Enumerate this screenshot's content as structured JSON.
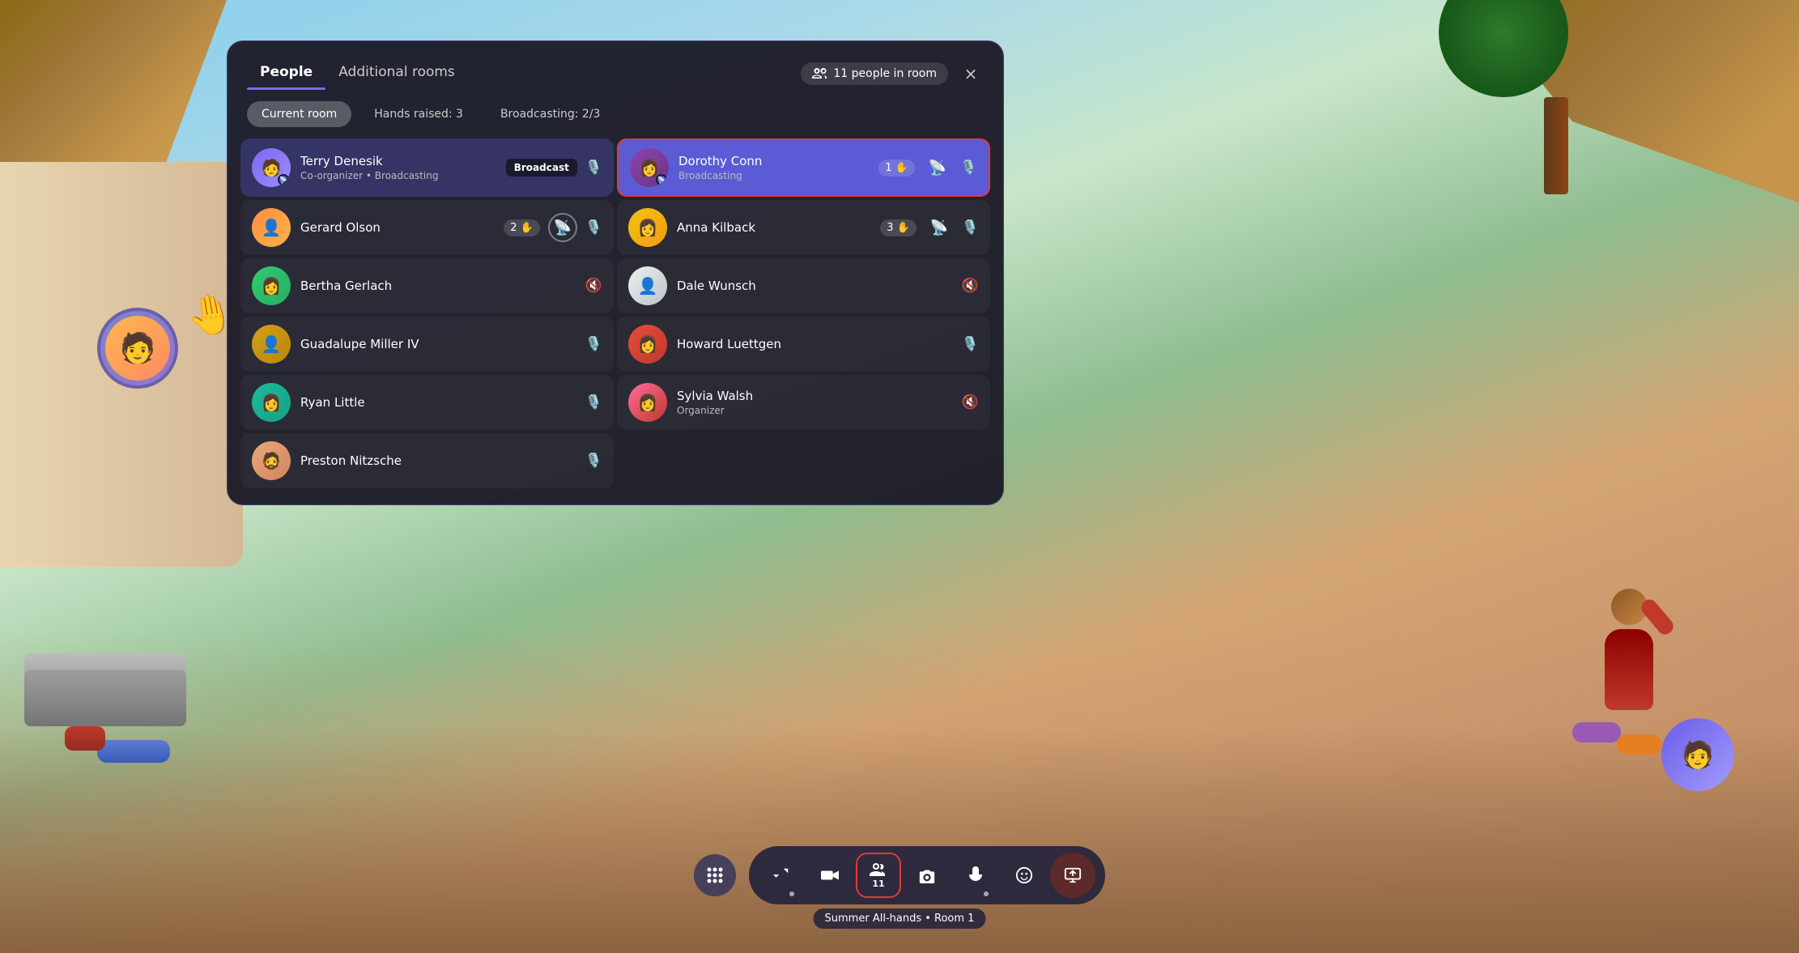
{
  "panel": {
    "tabs": [
      {
        "id": "people",
        "label": "People",
        "active": true
      },
      {
        "id": "additional-rooms",
        "label": "Additional rooms",
        "active": false
      }
    ],
    "people_count": "11 people in room",
    "close_label": "×",
    "filters": [
      {
        "id": "current-room",
        "label": "Current room",
        "active": true
      },
      {
        "id": "hands-raised",
        "label": "Hands raised: 3",
        "active": false
      },
      {
        "id": "broadcasting",
        "label": "Broadcasting: 2/3",
        "active": false
      }
    ],
    "left_column": [
      {
        "id": "terry",
        "name": "Terry Denesik",
        "role": "Co-organizer • Broadcasting",
        "avatar_color": "av-purple",
        "avatar_emoji": "🧑",
        "highlight": true,
        "badge": "Broadcast",
        "mic": "on",
        "has_broadcast_dot": true
      },
      {
        "id": "gerard",
        "name": "Gerard Olson",
        "role": "",
        "avatar_color": "av-orange",
        "avatar_emoji": "👤",
        "highlight": false,
        "hand_count": "2",
        "mic": "on",
        "has_broadcast_dot": false,
        "show_broadcast_icon": true
      },
      {
        "id": "bertha",
        "name": "Bertha Gerlach",
        "role": "",
        "avatar_color": "av-green",
        "avatar_emoji": "👤",
        "highlight": false,
        "mic": "off",
        "has_broadcast_dot": false
      },
      {
        "id": "guadalupe",
        "name": "Guadalupe Miller IV",
        "role": "",
        "avatar_color": "av-yellow",
        "avatar_emoji": "👤",
        "highlight": false,
        "mic": "on",
        "has_broadcast_dot": false
      },
      {
        "id": "ryan",
        "name": "Ryan Little",
        "role": "",
        "avatar_color": "av-teal",
        "avatar_emoji": "👤",
        "highlight": false,
        "mic": "on",
        "has_broadcast_dot": false
      },
      {
        "id": "preston",
        "name": "Preston Nitzsche",
        "role": "",
        "avatar_color": "av-pink",
        "avatar_emoji": "👤",
        "highlight": false,
        "mic": "on",
        "has_broadcast_dot": false
      }
    ],
    "right_column": [
      {
        "id": "dorothy",
        "name": "Dorothy Conn",
        "role": "Broadcasting",
        "avatar_color": "av-dark-purple",
        "avatar_emoji": "👤",
        "highlight": true,
        "red_border": true,
        "hand_count": "1",
        "mic": "on",
        "has_broadcast_dot": true,
        "show_broadcast_circle": true
      },
      {
        "id": "anna",
        "name": "Anna Kilback",
        "role": "",
        "avatar_color": "av-yellow",
        "avatar_emoji": "👤",
        "highlight": false,
        "hand_count": "3",
        "mic": "on",
        "has_broadcast_dot": false,
        "show_broadcast_icon": true
      },
      {
        "id": "dale",
        "name": "Dale Wunsch",
        "role": "",
        "avatar_color": "av-light",
        "avatar_emoji": "👤",
        "highlight": false,
        "mic": "off",
        "has_broadcast_dot": false
      },
      {
        "id": "howard",
        "name": "Howard Luettgen",
        "role": "",
        "avatar_color": "av-red",
        "avatar_emoji": "👤",
        "highlight": false,
        "mic": "on",
        "has_broadcast_dot": false
      },
      {
        "id": "sylvia",
        "name": "Sylvia Walsh",
        "role": "Organizer",
        "avatar_color": "av-pink",
        "avatar_emoji": "👤",
        "highlight": false,
        "mic": "off",
        "has_broadcast_dot": false
      }
    ]
  },
  "toolbar": {
    "apps_icon": "⊞",
    "buttons": [
      {
        "id": "share",
        "icon": "⬆",
        "label": "",
        "active": false,
        "has_sub": true
      },
      {
        "id": "camera",
        "icon": "🎥",
        "label": "",
        "active": false
      },
      {
        "id": "people",
        "icon": "👥",
        "label": "11",
        "active": true,
        "count": "11"
      },
      {
        "id": "camera2",
        "icon": "📷",
        "label": "",
        "active": false
      },
      {
        "id": "mic",
        "icon": "🎤",
        "label": "",
        "active": false,
        "has_sub": true
      },
      {
        "id": "emoji",
        "icon": "🙂",
        "label": "",
        "active": false
      },
      {
        "id": "more",
        "icon": "⊡",
        "label": "",
        "active": false,
        "dark": true
      }
    ]
  },
  "room_label": "Summer All-hands • Room 1"
}
